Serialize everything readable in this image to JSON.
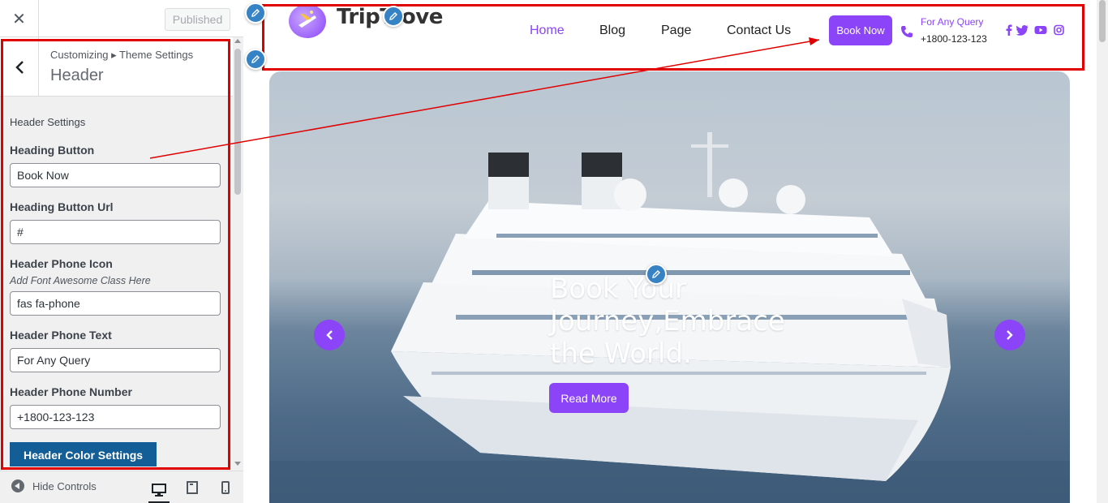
{
  "customizer": {
    "close_label": "✕",
    "published_label": "Published",
    "breadcrumb": "Customizing ▸ Theme Settings",
    "panel_title": "Header",
    "section_title": "Header Settings",
    "fields": [
      {
        "label": "Heading Button",
        "value": "Book Now"
      },
      {
        "label": "Heading Button Url",
        "value": "#"
      },
      {
        "label": "Header Phone Icon",
        "desc": "Add Font Awesome Class Here",
        "value": "fas fa-phone"
      },
      {
        "label": "Header Phone Text",
        "value": "For Any Query"
      },
      {
        "label": "Header Phone Number",
        "value": "+1800-123-123"
      }
    ],
    "color_button": "Header Color Settings",
    "hide_controls": "Hide Controls"
  },
  "site": {
    "logo_text": "TripTrove",
    "nav": [
      "Home",
      "Blog",
      "Page",
      "Contact Us"
    ],
    "book_button": "Book Now",
    "phone_text": "For Any Query",
    "phone_number": "+1800-123-123",
    "social_icons": [
      "facebook-icon",
      "twitter-icon",
      "youtube-icon",
      "instagram-icon"
    ],
    "hero_title": "Book Your Journey,Embrace the World.",
    "read_more": "Read More"
  },
  "colors": {
    "accent": "#8b44f7",
    "annotation": "#e00000",
    "wp_blue": "#135e96"
  }
}
